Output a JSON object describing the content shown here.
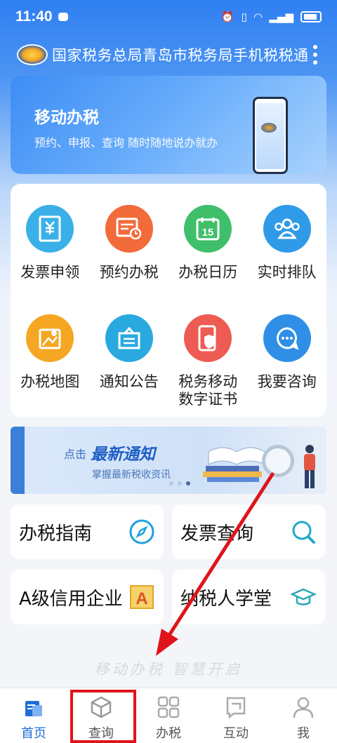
{
  "status_bar": {
    "time": "11:40"
  },
  "app": {
    "title": "国家税务总局青岛市税务局手机税税通"
  },
  "banner": {
    "title": "移动办税",
    "subtitle": "预约、申报、查询 随时随地说办就办"
  },
  "grid": [
    {
      "label": "发票申领",
      "color": "#3bb0e8",
      "icon": "invoice-icon"
    },
    {
      "label": "预约办税",
      "color": "#f26b3a",
      "icon": "appointment-icon"
    },
    {
      "label": "办税日历",
      "color": "#3fbf6a",
      "icon": "calendar-icon"
    },
    {
      "label": "实时排队",
      "color": "#2f9be8",
      "icon": "queue-icon"
    },
    {
      "label": "办税地图",
      "color": "#f5a623",
      "icon": "map-icon"
    },
    {
      "label": "通知公告",
      "color": "#29a9df",
      "icon": "notice-icon"
    },
    {
      "label": "税务移动\n数字证书",
      "color": "#ee5b52",
      "icon": "certificate-icon"
    },
    {
      "label": "我要咨询",
      "color": "#2f8fe6",
      "icon": "consult-icon"
    }
  ],
  "calendar_number": "15",
  "notice": {
    "click": "点击",
    "title": "最新通知",
    "subtitle": "掌握最新税收资讯"
  },
  "entries": [
    {
      "label": "办税指南",
      "icon": "compass-icon"
    },
    {
      "label": "发票查询",
      "icon": "search-icon"
    },
    {
      "label": "A级信用企业",
      "icon": "letter-a-icon",
      "badge": "A"
    },
    {
      "label": "纳税人学堂",
      "icon": "graduation-cap-icon"
    }
  ],
  "slogan": "移动办税  智慧开启",
  "tabs": [
    {
      "label": "首页",
      "icon": "home-icon",
      "active": true
    },
    {
      "label": "查询",
      "icon": "box-icon",
      "active": false
    },
    {
      "label": "办税",
      "icon": "grid-icon",
      "active": false
    },
    {
      "label": "互动",
      "icon": "chat-icon",
      "active": false
    },
    {
      "label": "我",
      "icon": "user-icon",
      "active": false
    }
  ],
  "colors": {
    "primary": "#1f6fd8",
    "annotation_red": "#e0141b"
  }
}
